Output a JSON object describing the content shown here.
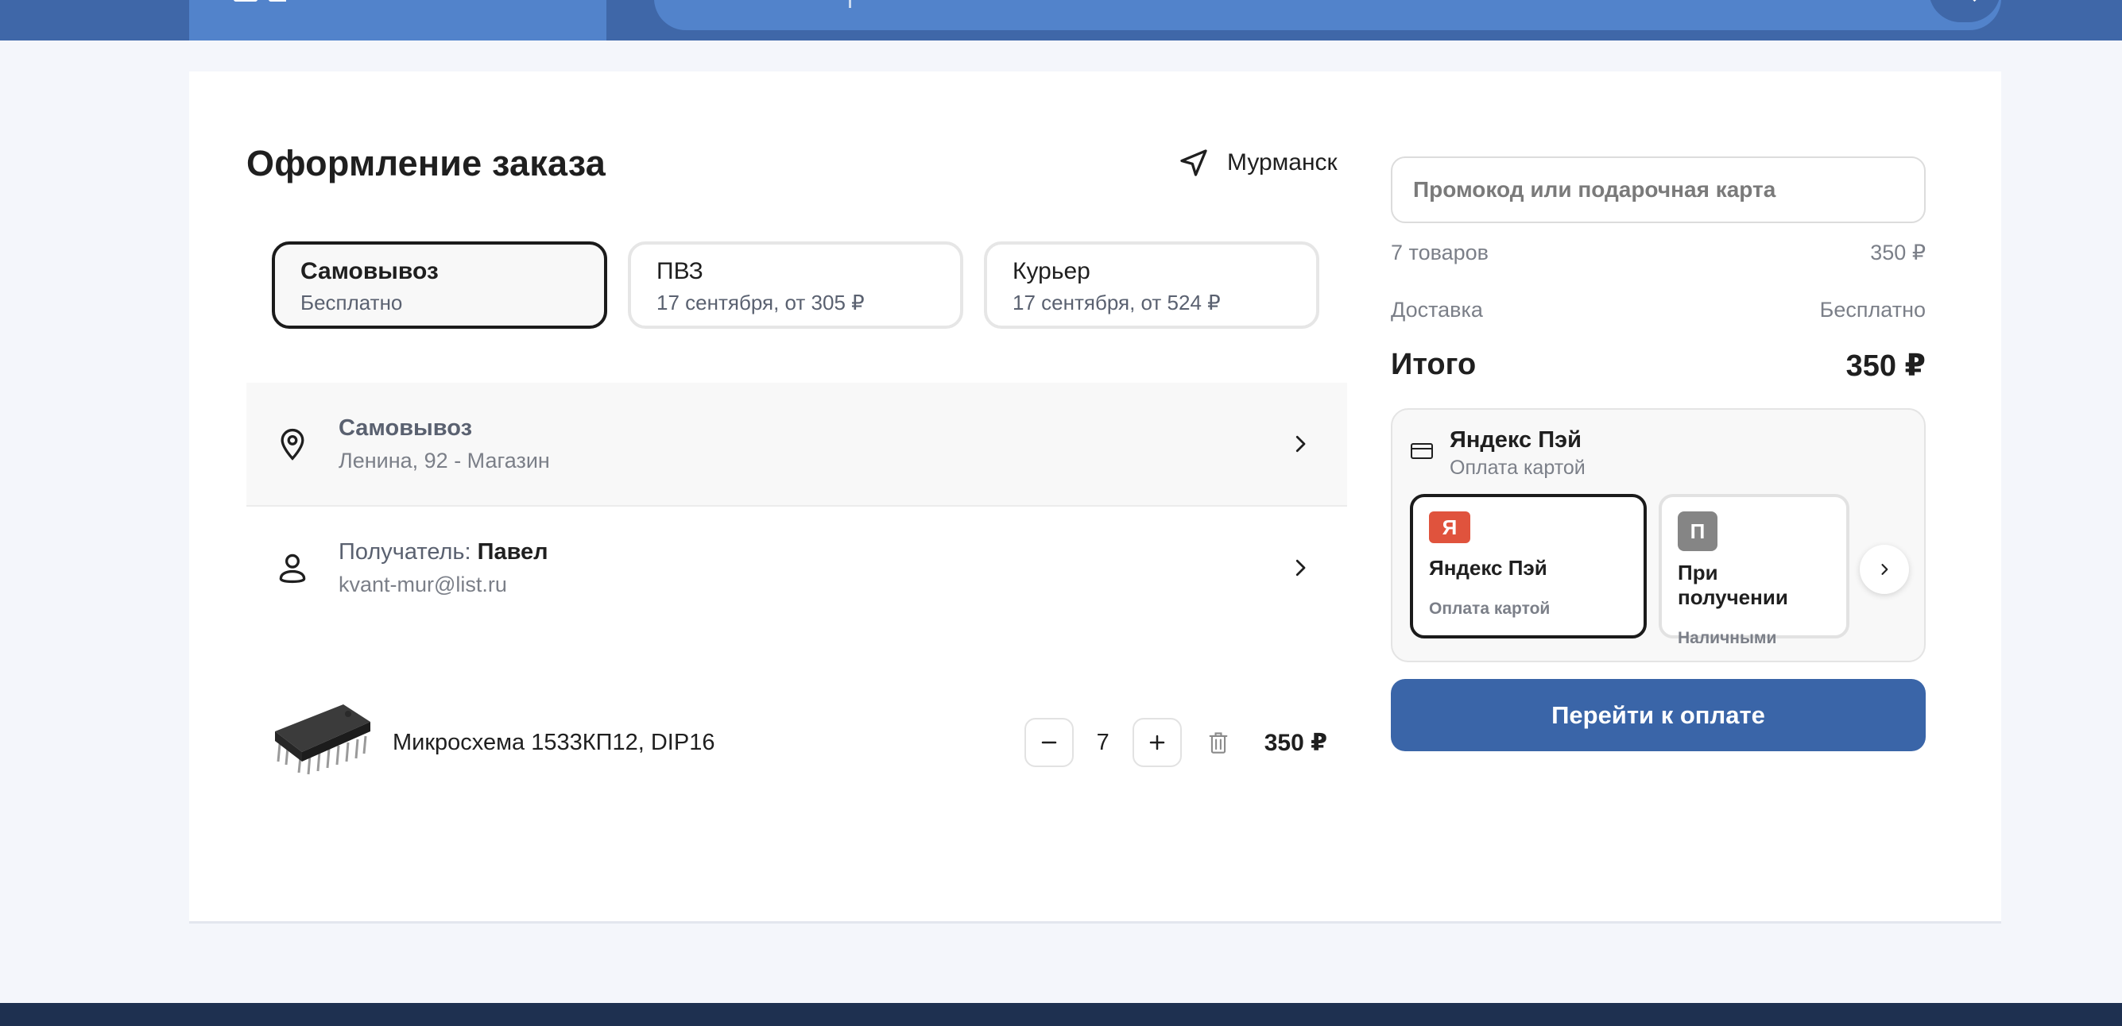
{
  "header": {
    "catalog_icon": "catalog-icon",
    "search_icon": "search-icon"
  },
  "checkout": {
    "title": "Оформление заказа",
    "city": "Мурманск",
    "city_icon": "navigation-arrow-icon"
  },
  "delivery_options": [
    {
      "title": "Самовывоз",
      "subtitle": "Бесплатно",
      "selected": true
    },
    {
      "title": "ПВЗ",
      "subtitle": "17 сентября, от 305 ₽",
      "selected": false
    },
    {
      "title": "Курьер",
      "subtitle": "17 сентября, от 524 ₽",
      "selected": false
    }
  ],
  "pickup": {
    "title": "Самовывоз",
    "address": "Ленина, 92 - Магазин"
  },
  "recipient": {
    "label": "Получатель: ",
    "name": "Павел",
    "email": "kvant-mur@list.ru"
  },
  "cart": {
    "items": [
      {
        "name": "Микросхема 1533КП12, DIP16",
        "quantity": "7",
        "price": "350 ₽"
      }
    ]
  },
  "summary": {
    "promo_placeholder": "Промокод или подарочная карта",
    "items_label": "7 товаров",
    "items_value": "350 ₽",
    "delivery_label": "Доставка",
    "delivery_value": "Бесплатно",
    "total_label": "Итого",
    "total_value": "350 ₽"
  },
  "payment": {
    "selected_title": "Яндекс Пэй",
    "selected_sub": "Оплата картой",
    "options": [
      {
        "logo": "Я",
        "title": "Яндекс Пэй",
        "subtitle": "Оплата картой",
        "color": "#e0533d",
        "selected": true
      },
      {
        "logo": "П",
        "title": "При получении",
        "subtitle": "Наличными",
        "color": "#858585",
        "selected": false
      }
    ]
  },
  "checkout_button": "Перейти к оплате",
  "colors": {
    "header": "#3f67a8",
    "accent": "#3a65a8",
    "footer": "#1e3050"
  }
}
